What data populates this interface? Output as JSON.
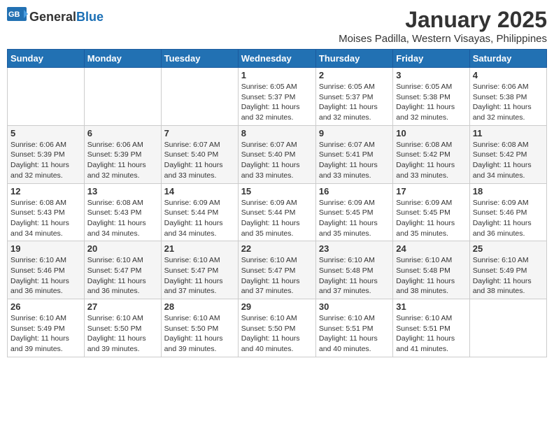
{
  "header": {
    "logo_general": "General",
    "logo_blue": "Blue",
    "title": "January 2025",
    "subtitle": "Moises Padilla, Western Visayas, Philippines"
  },
  "calendar": {
    "days_of_week": [
      "Sunday",
      "Monday",
      "Tuesday",
      "Wednesday",
      "Thursday",
      "Friday",
      "Saturday"
    ],
    "weeks": [
      [
        {
          "day": "",
          "info": ""
        },
        {
          "day": "",
          "info": ""
        },
        {
          "day": "",
          "info": ""
        },
        {
          "day": "1",
          "info": "Sunrise: 6:05 AM\nSunset: 5:37 PM\nDaylight: 11 hours\nand 32 minutes."
        },
        {
          "day": "2",
          "info": "Sunrise: 6:05 AM\nSunset: 5:37 PM\nDaylight: 11 hours\nand 32 minutes."
        },
        {
          "day": "3",
          "info": "Sunrise: 6:05 AM\nSunset: 5:38 PM\nDaylight: 11 hours\nand 32 minutes."
        },
        {
          "day": "4",
          "info": "Sunrise: 6:06 AM\nSunset: 5:38 PM\nDaylight: 11 hours\nand 32 minutes."
        }
      ],
      [
        {
          "day": "5",
          "info": "Sunrise: 6:06 AM\nSunset: 5:39 PM\nDaylight: 11 hours\nand 32 minutes."
        },
        {
          "day": "6",
          "info": "Sunrise: 6:06 AM\nSunset: 5:39 PM\nDaylight: 11 hours\nand 32 minutes."
        },
        {
          "day": "7",
          "info": "Sunrise: 6:07 AM\nSunset: 5:40 PM\nDaylight: 11 hours\nand 33 minutes."
        },
        {
          "day": "8",
          "info": "Sunrise: 6:07 AM\nSunset: 5:40 PM\nDaylight: 11 hours\nand 33 minutes."
        },
        {
          "day": "9",
          "info": "Sunrise: 6:07 AM\nSunset: 5:41 PM\nDaylight: 11 hours\nand 33 minutes."
        },
        {
          "day": "10",
          "info": "Sunrise: 6:08 AM\nSunset: 5:42 PM\nDaylight: 11 hours\nand 33 minutes."
        },
        {
          "day": "11",
          "info": "Sunrise: 6:08 AM\nSunset: 5:42 PM\nDaylight: 11 hours\nand 34 minutes."
        }
      ],
      [
        {
          "day": "12",
          "info": "Sunrise: 6:08 AM\nSunset: 5:43 PM\nDaylight: 11 hours\nand 34 minutes."
        },
        {
          "day": "13",
          "info": "Sunrise: 6:08 AM\nSunset: 5:43 PM\nDaylight: 11 hours\nand 34 minutes."
        },
        {
          "day": "14",
          "info": "Sunrise: 6:09 AM\nSunset: 5:44 PM\nDaylight: 11 hours\nand 34 minutes."
        },
        {
          "day": "15",
          "info": "Sunrise: 6:09 AM\nSunset: 5:44 PM\nDaylight: 11 hours\nand 35 minutes."
        },
        {
          "day": "16",
          "info": "Sunrise: 6:09 AM\nSunset: 5:45 PM\nDaylight: 11 hours\nand 35 minutes."
        },
        {
          "day": "17",
          "info": "Sunrise: 6:09 AM\nSunset: 5:45 PM\nDaylight: 11 hours\nand 35 minutes."
        },
        {
          "day": "18",
          "info": "Sunrise: 6:09 AM\nSunset: 5:46 PM\nDaylight: 11 hours\nand 36 minutes."
        }
      ],
      [
        {
          "day": "19",
          "info": "Sunrise: 6:10 AM\nSunset: 5:46 PM\nDaylight: 11 hours\nand 36 minutes."
        },
        {
          "day": "20",
          "info": "Sunrise: 6:10 AM\nSunset: 5:47 PM\nDaylight: 11 hours\nand 36 minutes."
        },
        {
          "day": "21",
          "info": "Sunrise: 6:10 AM\nSunset: 5:47 PM\nDaylight: 11 hours\nand 37 minutes."
        },
        {
          "day": "22",
          "info": "Sunrise: 6:10 AM\nSunset: 5:47 PM\nDaylight: 11 hours\nand 37 minutes."
        },
        {
          "day": "23",
          "info": "Sunrise: 6:10 AM\nSunset: 5:48 PM\nDaylight: 11 hours\nand 37 minutes."
        },
        {
          "day": "24",
          "info": "Sunrise: 6:10 AM\nSunset: 5:48 PM\nDaylight: 11 hours\nand 38 minutes."
        },
        {
          "day": "25",
          "info": "Sunrise: 6:10 AM\nSunset: 5:49 PM\nDaylight: 11 hours\nand 38 minutes."
        }
      ],
      [
        {
          "day": "26",
          "info": "Sunrise: 6:10 AM\nSunset: 5:49 PM\nDaylight: 11 hours\nand 39 minutes."
        },
        {
          "day": "27",
          "info": "Sunrise: 6:10 AM\nSunset: 5:50 PM\nDaylight: 11 hours\nand 39 minutes."
        },
        {
          "day": "28",
          "info": "Sunrise: 6:10 AM\nSunset: 5:50 PM\nDaylight: 11 hours\nand 39 minutes."
        },
        {
          "day": "29",
          "info": "Sunrise: 6:10 AM\nSunset: 5:50 PM\nDaylight: 11 hours\nand 40 minutes."
        },
        {
          "day": "30",
          "info": "Sunrise: 6:10 AM\nSunset: 5:51 PM\nDaylight: 11 hours\nand 40 minutes."
        },
        {
          "day": "31",
          "info": "Sunrise: 6:10 AM\nSunset: 5:51 PM\nDaylight: 11 hours\nand 41 minutes."
        },
        {
          "day": "",
          "info": ""
        }
      ]
    ]
  }
}
